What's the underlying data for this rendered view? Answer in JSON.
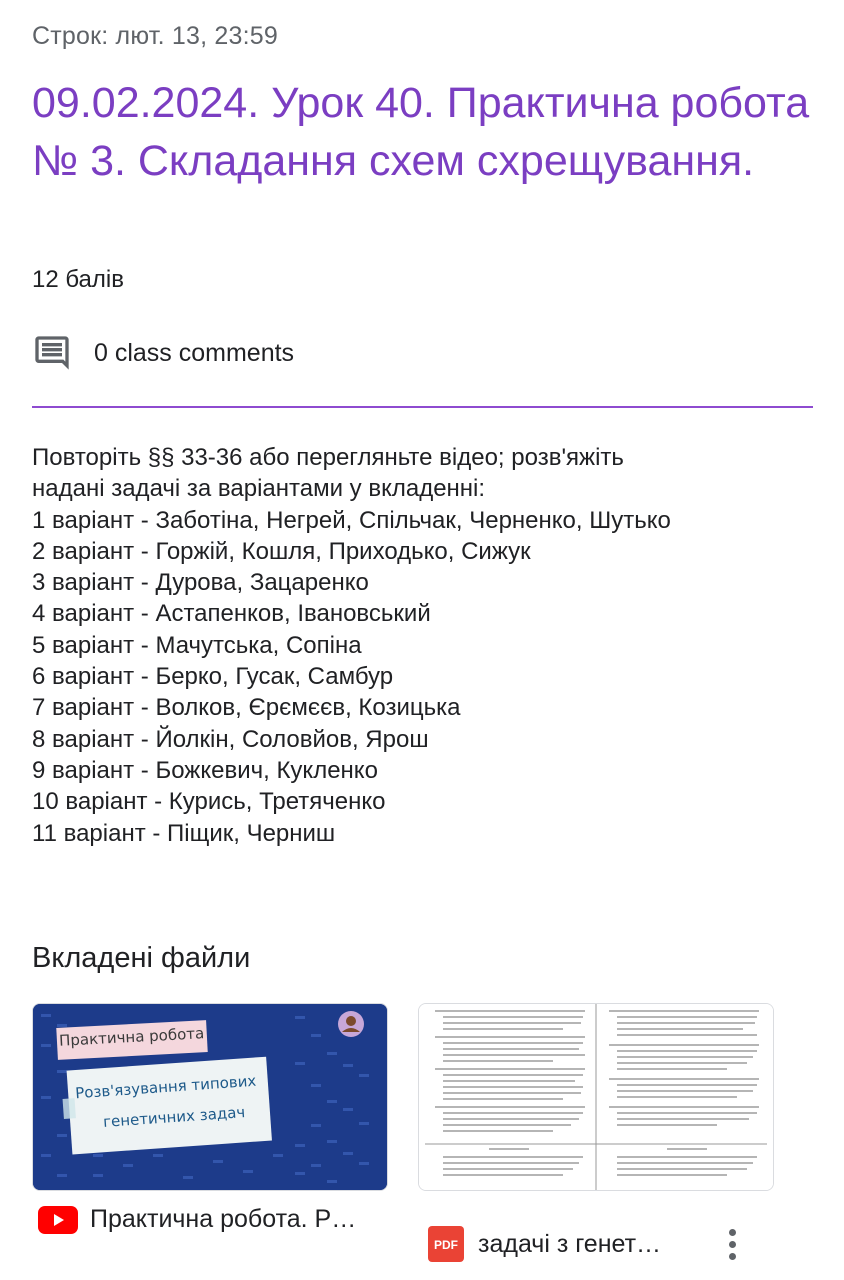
{
  "assignment": {
    "due": "Строк: лют. 13, 23:59",
    "title": "09.02.2024. Урок 40. Практична робота № 3. Складання схем схрещування.",
    "points": "12 балів",
    "comments_label": "0 class comments",
    "description": [
      "Повторіть §§ 33-36 або перегляньте відео; розв'яжіть",
      "надані задачі за варіантами у вкладенні:",
      "1 варіант - Заботіна, Негрей, Спільчак, Черненко, Шутько",
      "2 варіант - Горжій, Кошля, Приходько, Сижук",
      "3 варіант - Дурова, Зацаренко",
      "4 варіант - Астапенков, Івановський",
      "5 варіант - Мачутська, Сопіна",
      "6 варіант - Берко, Гусак, Самбур",
      "7 варіант - Волков, Єрємєєв, Козицька",
      "8 варіант - Йолкін, Соловйов, Ярош",
      "9 варіант - Божкевич, Кукленко",
      "10 варіант - Курись, Третяченко",
      "11 варіант - Піщик, Черниш"
    ]
  },
  "attachments": {
    "heading": "Вкладені файли",
    "items": [
      {
        "type": "youtube",
        "name": "Практична робота. Р…",
        "thumb_line1": "Практична робота",
        "thumb_line2": "Розв'язування типових",
        "thumb_line3": "генетичних задач"
      },
      {
        "type": "pdf",
        "name": "задачі з генет…",
        "badge": "PDF"
      }
    ]
  },
  "colors": {
    "accent": "#7b3ec2",
    "divider": "#8e4bd0",
    "youtube_red": "#ff0000",
    "pdf_red": "#ea4335"
  }
}
